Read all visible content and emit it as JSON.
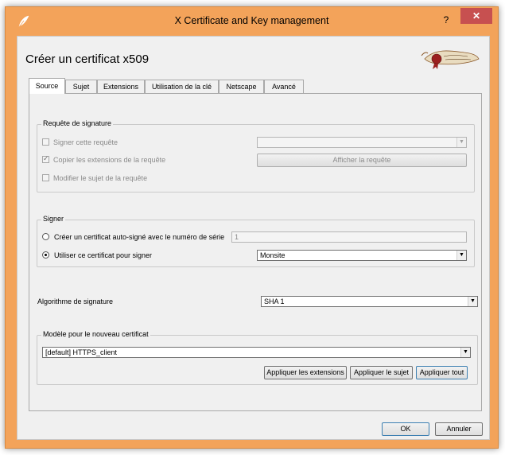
{
  "window": {
    "title": "X Certificate and Key management",
    "help_label": "?",
    "close_label": "✕"
  },
  "dialog": {
    "heading": "Créer un certificat x509"
  },
  "tabs": [
    {
      "label": "Source"
    },
    {
      "label": "Sujet"
    },
    {
      "label": "Extensions"
    },
    {
      "label": "Utilisation de la clé"
    },
    {
      "label": "Netscape"
    },
    {
      "label": "Avancé"
    }
  ],
  "signing_request": {
    "title": "Requête de signature",
    "sign_request_label": "Signer cette requête",
    "copy_extensions_label": "Copier les extensions de la requête",
    "modify_subject_label": "Modifier le sujet de la requête",
    "show_request_label": "Afficher la requête",
    "request_combo_value": ""
  },
  "signer": {
    "title": "Signer",
    "self_signed_label": "Créer un certificat auto-signé avec le numéro de série",
    "serial_value": "1",
    "use_certificate_label": "Utiliser ce certificat pour signer",
    "certificate_value": "Monsite"
  },
  "algorithm": {
    "label": "Algorithme de signature",
    "value": "SHA 1"
  },
  "template": {
    "title": "Modèle pour le nouveau certificat",
    "value": "[default] HTTPS_client",
    "apply_extensions_label": "Appliquer les extensions",
    "apply_subject_label": "Appliquer le sujet",
    "apply_all_label": "Appliquer tout"
  },
  "footer": {
    "ok_label": "OK",
    "cancel_label": "Annuler"
  },
  "colors": {
    "frame": "#f3a35a",
    "close_button": "#c75050",
    "client": "#f0f0f0"
  }
}
